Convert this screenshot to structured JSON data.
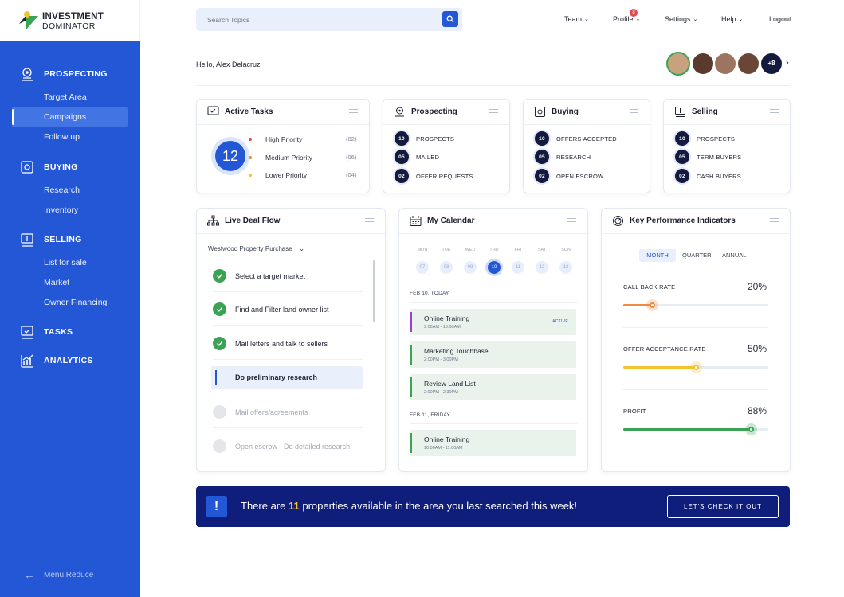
{
  "app": {
    "brand_line1": "INVESTMENT",
    "brand_line2": "DOMINATOR"
  },
  "header": {
    "search_placeholder": "Search Topics",
    "nav": [
      {
        "label": "Team"
      },
      {
        "label": "Profile"
      },
      {
        "label": "Settings"
      },
      {
        "label": "Help"
      },
      {
        "label": "Logout"
      }
    ],
    "profile_badge": "8"
  },
  "sidebar": {
    "sections": [
      {
        "label": "PROSPECTING",
        "icon": "prospecting-icon",
        "items": [
          "Target Area",
          "Campaigns",
          "Follow up"
        ],
        "active": "Campaigns"
      },
      {
        "label": "BUYING",
        "icon": "buying-icon",
        "items": [
          "Research",
          "Inventory"
        ]
      },
      {
        "label": "SELLING",
        "icon": "selling-icon",
        "items": [
          "List for sale",
          "Market",
          "Owner Financing"
        ]
      },
      {
        "label": "TASKS",
        "icon": "tasks-icon",
        "items": []
      },
      {
        "label": "ANALYTICS",
        "icon": "analytics-icon",
        "items": []
      }
    ],
    "menu_reduce": "Menu Reduce"
  },
  "greeting": "Hello, Alex Delacruz",
  "team_more": "+8",
  "active_tasks": {
    "title": "Active Tasks",
    "total": "12",
    "priorities": [
      {
        "label": "High Priority",
        "count": "(02)",
        "color": "#e04c4c"
      },
      {
        "label": "Medium Priority",
        "count": "(06)",
        "color": "#f08a2c"
      },
      {
        "label": "Lower Priority",
        "count": "(04)",
        "color": "#f2c230"
      }
    ]
  },
  "prospecting": {
    "title": "Prospecting",
    "rows": [
      {
        "n": "10",
        "label": "PROSPECTS"
      },
      {
        "n": "05",
        "label": "MAILED"
      },
      {
        "n": "02",
        "label": "OFFER REQUESTS"
      }
    ]
  },
  "buying": {
    "title": "Buying",
    "rows": [
      {
        "n": "10",
        "label": "OFFERS ACCEPTED"
      },
      {
        "n": "05",
        "label": "RESEARCH"
      },
      {
        "n": "02",
        "label": "OPEN ESCROW"
      }
    ]
  },
  "selling": {
    "title": "Selling",
    "rows": [
      {
        "n": "10",
        "label": "PROSPECTS"
      },
      {
        "n": "05",
        "label": "TERM BUYERS"
      },
      {
        "n": "02",
        "label": "CASH BUYERS"
      }
    ]
  },
  "deal_flow": {
    "title": "Live Deal Flow",
    "property": "Westwood Property Purchase",
    "steps": [
      {
        "label": "Select a target market",
        "status": "done"
      },
      {
        "label": "Find and Filter land owner list",
        "status": "done"
      },
      {
        "label": "Mail letters and talk to sellers",
        "status": "done"
      },
      {
        "label": "Do preliminary research",
        "status": "current"
      },
      {
        "label": "Mail offers/agreements",
        "status": "pending"
      },
      {
        "label": "Open escrow · Do detailed research",
        "status": "pending"
      }
    ]
  },
  "calendar": {
    "title": "My Calendar",
    "days": [
      {
        "name": "MON",
        "num": "07"
      },
      {
        "name": "TUE",
        "num": "08"
      },
      {
        "name": "WED",
        "num": "09"
      },
      {
        "name": "THU",
        "num": "10"
      },
      {
        "name": "FRI",
        "num": "11"
      },
      {
        "name": "SAT",
        "num": "12"
      },
      {
        "name": "SUN",
        "num": "13"
      }
    ],
    "selected": "10",
    "groups": [
      {
        "heading": "FEB 10, TODAY",
        "events": [
          {
            "title": "Online Training",
            "time": "9:00AM - 10:00AM",
            "tag": "ACTIVE"
          },
          {
            "title": "Marketing Touchbase",
            "time": "2:00PM - 3:00PM",
            "tag": ""
          },
          {
            "title": "Review Land List",
            "time": "2:00PM - 2:30PM",
            "tag": ""
          }
        ]
      },
      {
        "heading": "FEB 11, FRIDAY",
        "events": [
          {
            "title": "Online Training",
            "time": "10:00AM - 11:00AM",
            "tag": ""
          }
        ]
      }
    ]
  },
  "kpi": {
    "title": "Key Performance Indicators",
    "tabs": [
      "MONTH",
      "QUARTER",
      "ANNUAL"
    ],
    "active_tab": "MONTH",
    "metrics": [
      {
        "label": "CALL BACK RATE",
        "value": "20%",
        "level": 0.2,
        "color": "#f08a3c"
      },
      {
        "label": "OFFER ACCEPTANCE RATE",
        "value": "50%",
        "level": 0.5,
        "color": "#f2c230"
      },
      {
        "label": "PROFIT",
        "value": "88%",
        "level": 0.88,
        "color": "#3aa354"
      }
    ]
  },
  "banner": {
    "pre": "There are ",
    "count": "11",
    "post": " properties available in the area you last searched this week!",
    "cta": "LET'S CHECK IT OUT"
  }
}
